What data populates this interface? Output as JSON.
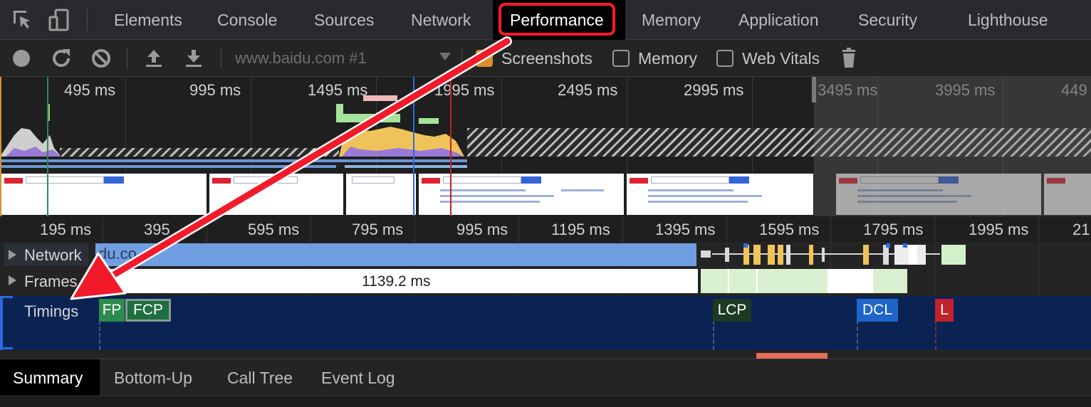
{
  "tabs": [
    {
      "label": "Elements"
    },
    {
      "label": "Console"
    },
    {
      "label": "Sources"
    },
    {
      "label": "Network"
    },
    {
      "label": "Performance",
      "active": true
    },
    {
      "label": "Memory"
    },
    {
      "label": "Application"
    },
    {
      "label": "Security"
    },
    {
      "label": "Lighthouse"
    }
  ],
  "toolbar": {
    "record_icon": "record-icon",
    "reload_icon": "reload-icon",
    "clear_icon": "clear-icon",
    "upload_icon": "upload-icon",
    "download_icon": "download-icon",
    "profile_select": "www.baidu.com #1",
    "screenshots_label": "Screenshots",
    "screenshots_checked": true,
    "memory_label": "Memory",
    "memory_checked": false,
    "webvitals_label": "Web Vitals",
    "webvitals_checked": false,
    "trash_icon": "trash-icon"
  },
  "overview": {
    "tick_labels": [
      "495 ms",
      "995 ms",
      "1495 ms",
      "1995 ms",
      "2495 ms",
      "2995 ms",
      "3495 ms",
      "3995 ms",
      "449"
    ]
  },
  "ruler": {
    "tick_labels": [
      "195 ms",
      "395",
      "595 ms",
      "795 ms",
      "995 ms",
      "1195 ms",
      "1395 ms",
      "1595 ms",
      "1795 ms",
      "1995 ms",
      "21"
    ]
  },
  "tracks": {
    "network_label": "Network",
    "network_url_fragment": "du.co",
    "frames_label": "Frames",
    "frames_duration": "1139.2 ms",
    "timings_label": "Timings"
  },
  "timings": {
    "fp": "FP",
    "fcp": "FCP",
    "lcp": "LCP",
    "dcl": "DCL",
    "l": "L"
  },
  "colors": {
    "highlight": "#ff1a2a",
    "fp": "#2e8b4e",
    "fcp": "#1e6e40",
    "lcp": "#1c3a24",
    "dcl": "#1f64c8",
    "load": "#c0232d",
    "timings_bg": "#0b2353"
  },
  "bottom_tabs": [
    {
      "label": "Summary",
      "active": true
    },
    {
      "label": "Bottom-Up"
    },
    {
      "label": "Call Tree"
    },
    {
      "label": "Event Log"
    }
  ]
}
